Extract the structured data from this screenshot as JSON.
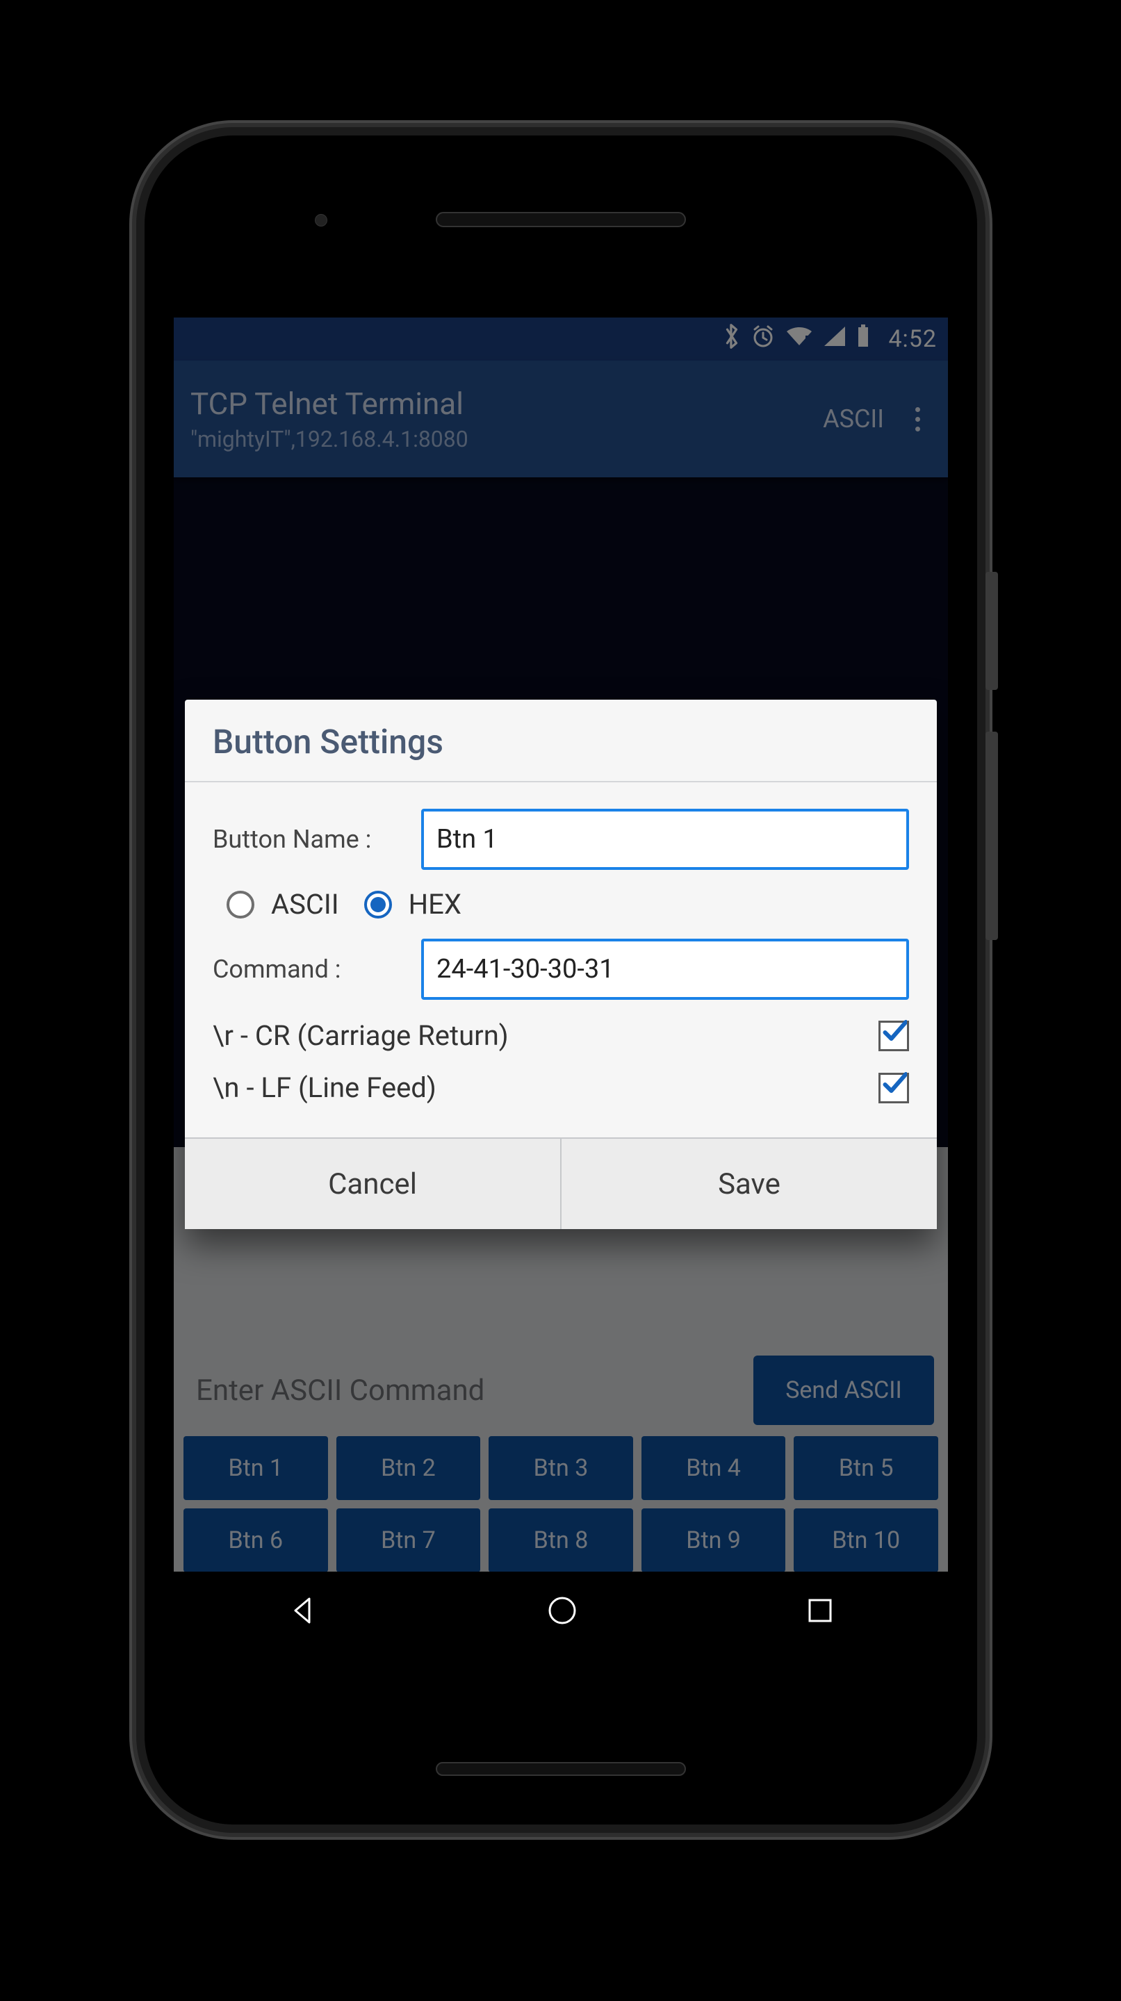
{
  "status": {
    "time": "4:52",
    "icons": {
      "bluetooth": "bluetooth-icon",
      "alarm": "alarm-icon",
      "wifi": "wifi-alert-icon",
      "signal": "cell-signal-icon",
      "battery": "battery-full-icon"
    }
  },
  "appbar": {
    "title": "TCP Telnet Terminal",
    "subtitle": "\"mightyIT\",192.168.4.1:8080",
    "action_mode": "ASCII"
  },
  "dialog": {
    "title": "Button Settings",
    "button_name_label": "Button Name :",
    "button_name_value": "Btn 1",
    "encoding": {
      "ascii_label": "ASCII",
      "hex_label": "HEX",
      "selected": "HEX"
    },
    "command_label": "Command    :",
    "command_value": "24-41-30-30-31",
    "cr_label": "\\r - CR (Carriage Return)",
    "cr_checked": true,
    "lf_label": "\\n - LF (Line Feed)",
    "lf_checked": true,
    "cancel_label": "Cancel",
    "save_label": "Save"
  },
  "input_row": {
    "placeholder": "Enter ASCII Command",
    "send_label": "Send ASCII"
  },
  "quick_buttons": [
    "Btn 1",
    "Btn 2",
    "Btn 3",
    "Btn 4",
    "Btn 5",
    "Btn 6",
    "Btn 7",
    "Btn 8",
    "Btn 9",
    "Btn 10"
  ]
}
